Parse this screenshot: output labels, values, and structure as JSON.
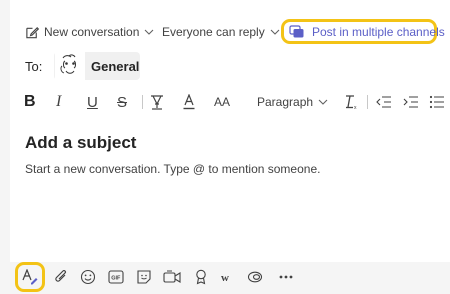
{
  "compose": {
    "new_conversation_label": "New conversation",
    "reply_setting_label": "Everyone can reply",
    "post_multiple_label": "Post in multiple channels",
    "to_label": "To:",
    "channel_name": "General",
    "paragraph_label": "Paragraph",
    "bold_glyph": "B",
    "italic_glyph": "I",
    "underline_glyph": "U",
    "strike_glyph": "S",
    "font_size_glyph": "AA",
    "subject_placeholder": "Add a subject",
    "body_placeholder": "Start a new conversation. Type @ to mention someone."
  },
  "colors": {
    "accent": "#5b5fc7",
    "highlight": "#f3c316"
  }
}
